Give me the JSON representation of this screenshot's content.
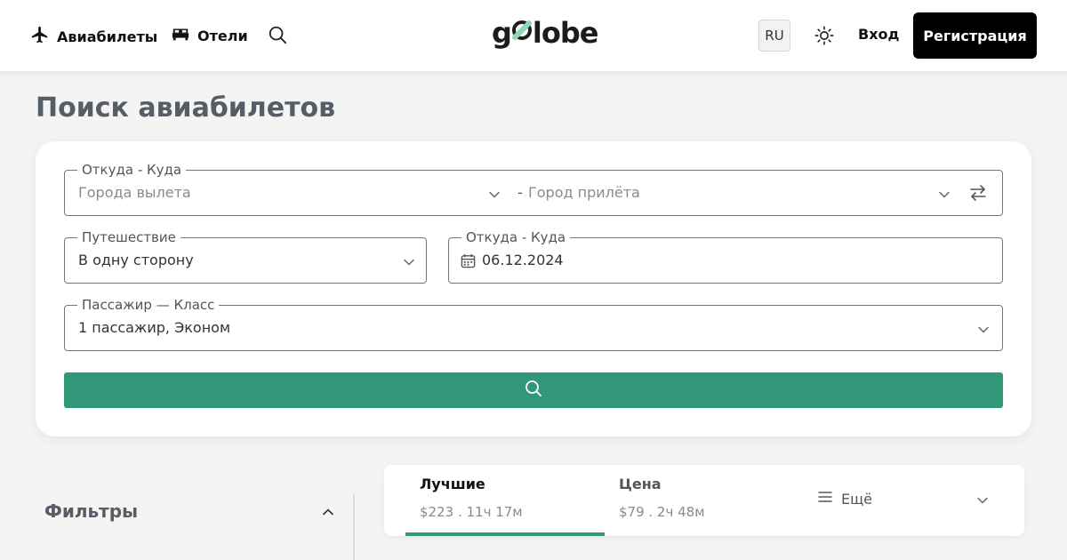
{
  "header": {
    "nav_flights": "Авиабилеты",
    "nav_hotels": "Отели",
    "logo_text_start": "g",
    "logo_text_end": "lobe",
    "language": "RU",
    "login": "Вход",
    "register": "Регистрация"
  },
  "page": {
    "title": "Поиск авиабилетов"
  },
  "search_form": {
    "route_legend": "Откуда - Куда",
    "origin_placeholder": "Города вылета",
    "route_separator": "-",
    "destination_placeholder": "Город прилёта",
    "trip_legend": "Путешествие",
    "trip_value": "В одну сторону",
    "date_legend": "Откуда - Куда",
    "date_value": "06.12.2024",
    "passenger_legend": "Пассажир — Класс",
    "passenger_value": "1 пассажир, Эконом"
  },
  "filters": {
    "title": "Фильтры"
  },
  "sort_tabs": [
    {
      "title": "Лучшие",
      "subtitle": "$223 . 11ч 17м"
    },
    {
      "title": "Цена",
      "subtitle": "$79 . 2ч 48м"
    }
  ],
  "sort_more": "Ещё",
  "colors": {
    "accent": "#329679",
    "register_bg": "#000000",
    "title_text": "#555d66"
  },
  "icons": [
    "plane-icon",
    "bed-icon",
    "search-icon",
    "sun-icon",
    "chevron-down-icon",
    "swap-icon",
    "calendar-icon",
    "menu-icon",
    "chevron-up-icon"
  ]
}
